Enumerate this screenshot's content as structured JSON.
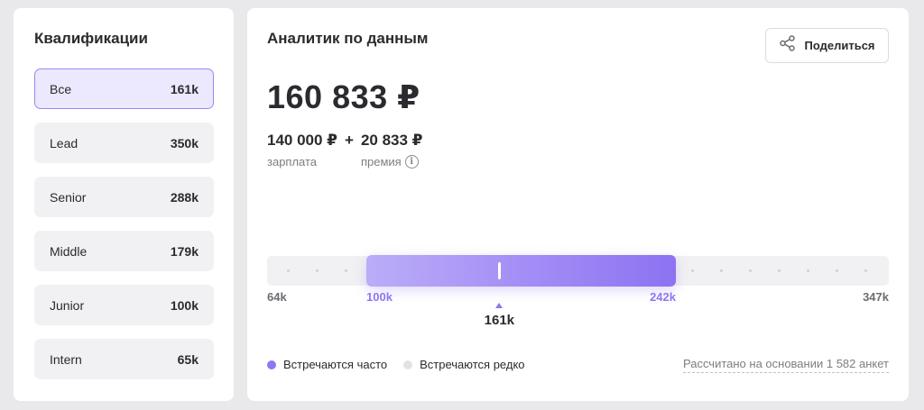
{
  "left": {
    "title": "Квалификации",
    "levels": [
      {
        "name": "Все",
        "value": "161k"
      },
      {
        "name": "Lead",
        "value": "350k"
      },
      {
        "name": "Senior",
        "value": "288k"
      },
      {
        "name": "Middle",
        "value": "179k"
      },
      {
        "name": "Junior",
        "value": "100k"
      },
      {
        "name": "Intern",
        "value": "65k"
      }
    ],
    "selected_index": 0
  },
  "main": {
    "title": "Аналитик по данным",
    "share_label": "Поделиться",
    "total": "160 833 ₽",
    "salary_value": "140 000 ₽",
    "salary_label": "зарплата",
    "plus": "+",
    "bonus_value": "20 833 ₽",
    "bonus_label": "премия",
    "info_glyph": "i"
  },
  "range": {
    "min_label": "64k",
    "max_label": "347k",
    "low_label": "100k",
    "high_label": "242k",
    "median_label": "161k",
    "min": 64,
    "max": 347,
    "low": 100,
    "high": 242,
    "median": 161
  },
  "legend": {
    "frequent": "Встречаются часто",
    "rare": "Встречаются редко",
    "frequent_color": "#8f76f3",
    "rare_color": "#e2e2e6"
  },
  "basis_text": "Рассчитано на основании 1 582 анкет",
  "icons": {
    "share": "share-icon",
    "info": "info-icon"
  }
}
